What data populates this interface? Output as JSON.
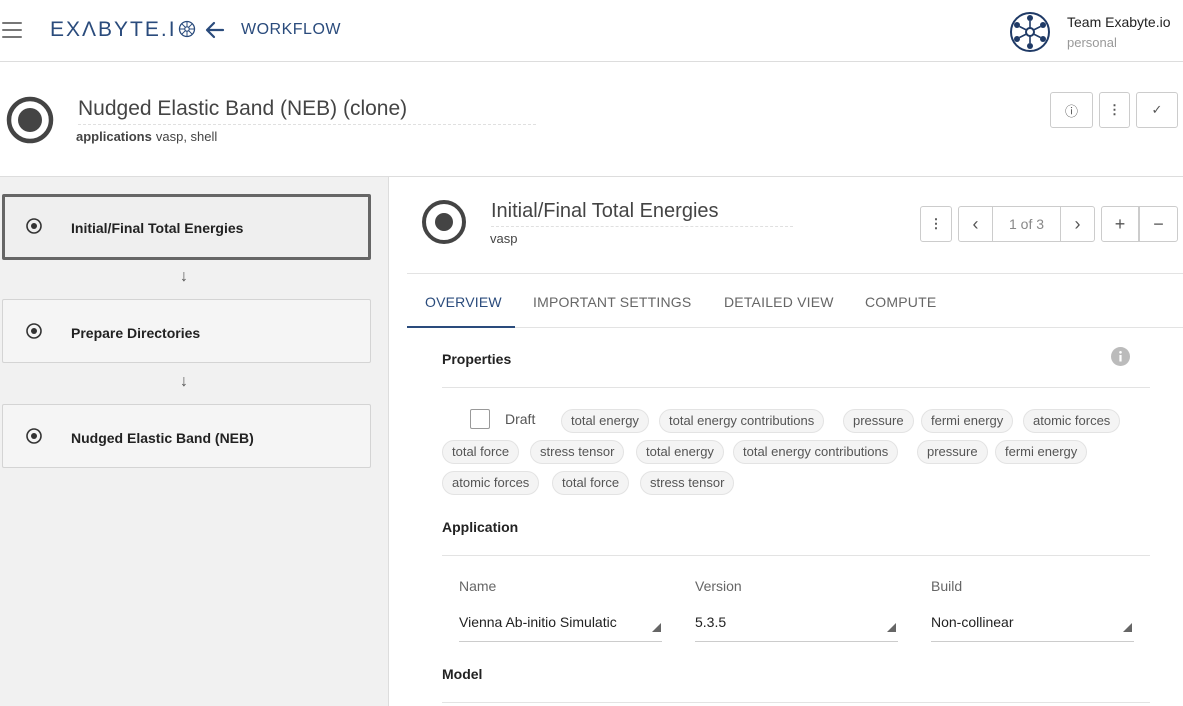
{
  "topbar": {
    "brand": "EXΛBYTE.I",
    "crumb": "WORKFLOW",
    "team_name": "Team Exabyte.io",
    "team_sub": "personal"
  },
  "workflow": {
    "title": "Nudged Elastic Band (NEB) (clone)",
    "applications_label": "applications",
    "applications_value": "vasp, shell"
  },
  "units": [
    {
      "label": "Initial/Final Total Energies",
      "active": true
    },
    {
      "label": "Prepare Directories",
      "active": false
    },
    {
      "label": "Nudged Elastic Band (NEB)",
      "active": false
    }
  ],
  "arrow_glyph": "↓",
  "unit": {
    "title": "Initial/Final Total Energies",
    "app": "vasp",
    "pager": "1 of 3"
  },
  "tabs": [
    "OVERVIEW",
    "IMPORTANT SETTINGS",
    "DETAILED VIEW",
    "COMPUTE"
  ],
  "properties": {
    "title": "Properties",
    "draft_label": "Draft",
    "chips": [
      "total energy",
      "total energy contributions",
      "pressure",
      "fermi energy",
      "atomic forces",
      "total force",
      "stress tensor",
      "total energy",
      "total energy contributions",
      "pressure",
      "fermi energy",
      "atomic forces",
      "total force",
      "stress tensor"
    ]
  },
  "application": {
    "title": "Application",
    "fields": [
      {
        "label": "Name",
        "value": "Vienna Ab-initio Simulatic"
      },
      {
        "label": "Version",
        "value": "5.3.5"
      },
      {
        "label": "Build",
        "value": "Non-collinear"
      }
    ]
  },
  "model": {
    "title": "Model"
  },
  "buttons": {
    "info": "ⓘ",
    "more": "⋮",
    "check": "✓",
    "prev": "‹",
    "next": "›",
    "add": "+",
    "remove": "−"
  },
  "colors": {
    "accent": "#2a4b7c",
    "panel_bg": "#f1f1f1"
  },
  "icons": [
    "menu-icon",
    "back-arrow-icon",
    "radio-target-icon",
    "info-icon",
    "more-vert-icon",
    "check-icon",
    "chevron-left-icon",
    "chevron-right-icon",
    "plus-icon",
    "minus-icon"
  ]
}
